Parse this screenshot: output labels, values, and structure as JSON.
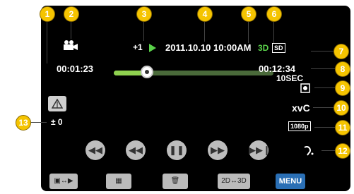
{
  "callouts": [
    "1",
    "2",
    "3",
    "4",
    "5",
    "6",
    "7",
    "8",
    "9",
    "10",
    "11",
    "12",
    "13"
  ],
  "status": {
    "elapsed_time": "00:01:23",
    "total_time": "00:12:34",
    "speed": "+1",
    "date_time": "2011.10.10 10:00AM",
    "badge_3d": "3D",
    "badge_sd": "SD",
    "skip_interval": "10SEC",
    "codec": "xvC",
    "resolution": "1080p",
    "parallax": "± 0"
  },
  "playback": {
    "progress": 0.21
  },
  "bottom_buttons": {
    "menu_label": "MENU",
    "mode_label": "2D↔3D"
  },
  "icons": [
    "movie-camera-icon",
    "play-arrow-icon",
    "protect-icon",
    "parallax-icon",
    "rewind-icon",
    "slow-rewind-icon",
    "pause-icon",
    "slow-forward-icon",
    "skip-forward-icon",
    "hearing-icon",
    "switch-icon",
    "index-icon",
    "trash-icon"
  ],
  "colors": {
    "seek_fill": "#8fd14f",
    "badge_3d": "#5ad14a",
    "callout": "#f5c400",
    "menu": "#2a6fb5"
  }
}
